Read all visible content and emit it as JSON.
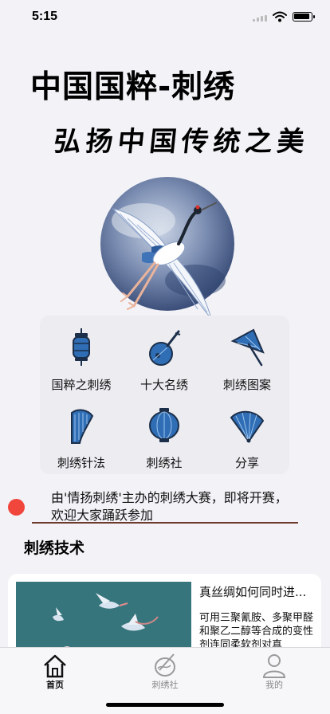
{
  "status_bar": {
    "time": "5:15"
  },
  "header": {
    "title": "中国国粹-刺绣",
    "subtitle": "弘扬中国传统之美"
  },
  "grid": {
    "items": [
      {
        "label": "国粹之刺绣",
        "icon": "lantern-icon"
      },
      {
        "label": "十大名绣",
        "icon": "pipa-icon"
      },
      {
        "label": "刺绣图案",
        "icon": "umbrella-icon"
      },
      {
        "label": "刺绣针法",
        "icon": "harp-icon"
      },
      {
        "label": "刺绣社",
        "icon": "round-lantern-icon"
      },
      {
        "label": "分享",
        "icon": "fan-icon"
      }
    ],
    "icon_fill": "#2f6db5",
    "icon_stroke": "#1c2f4a"
  },
  "notice": {
    "text": "由'情扬刺绣'主办的刺绣大赛，即将开赛，欢迎大家踊跃参加",
    "dot_color": "#f0463c"
  },
  "section": {
    "title": "刺绣技术"
  },
  "article": {
    "title": "真丝绸如何同时进...",
    "body": "可用三聚氰胺、多聚甲醛和聚乙二醇等合成的变性剂连同柔软剂对真"
  },
  "tabbar": {
    "tabs": [
      {
        "label": "首页",
        "icon": "home-icon",
        "active": true
      },
      {
        "label": "刺绣社",
        "icon": "embroidery-hoop-icon",
        "active": false
      },
      {
        "label": "我的",
        "icon": "person-icon",
        "active": false
      }
    ]
  }
}
